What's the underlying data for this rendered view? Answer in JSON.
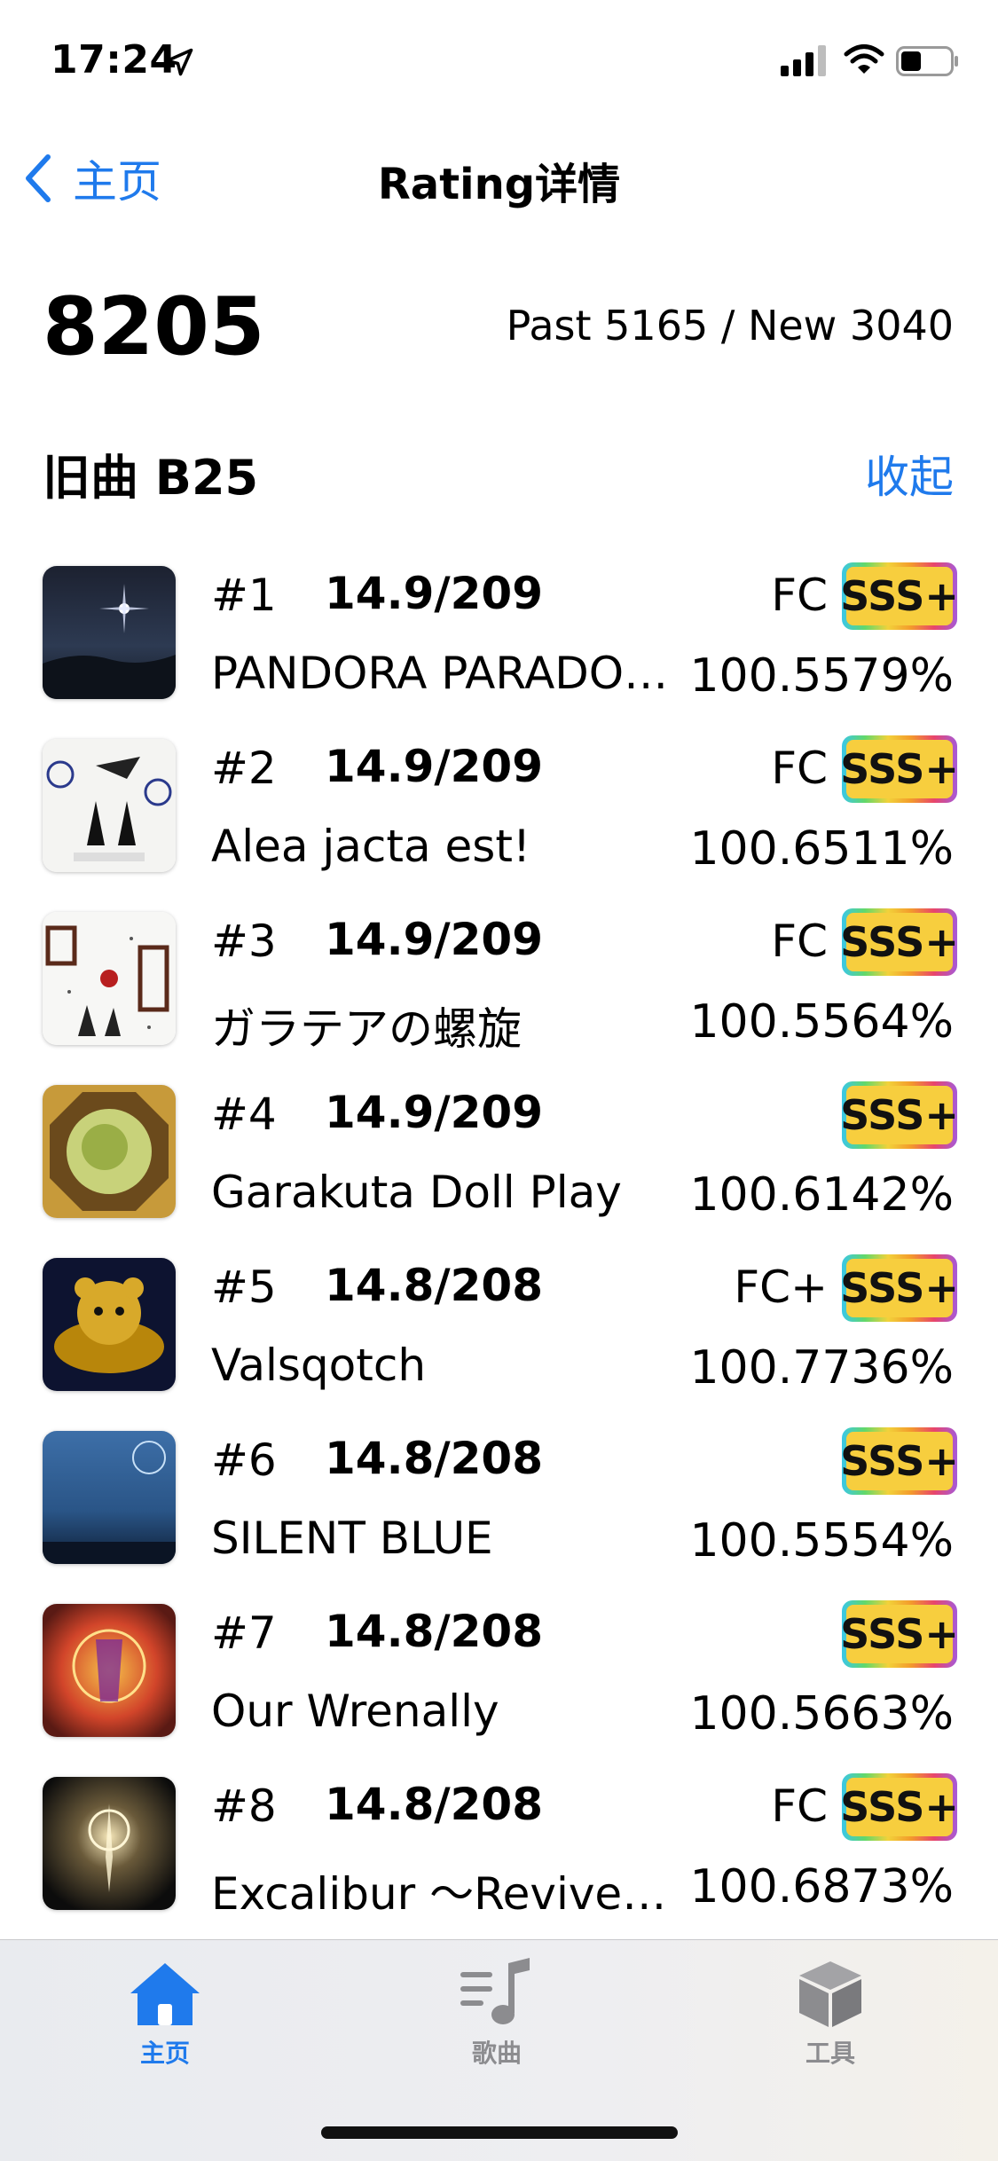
{
  "status_bar": {
    "time": "17:24"
  },
  "nav": {
    "back_label": "主页",
    "title": "Rating详情"
  },
  "summary": {
    "total": "8205",
    "breakdown": "Past 5165 / New 3040"
  },
  "section": {
    "title": "旧曲 B25",
    "toggle": "收起"
  },
  "songs": [
    {
      "rank": "#1",
      "level": "14.9/209",
      "title": "PANDORA PARADO…",
      "combo": "FC",
      "grade": "SSS+",
      "accuracy": "100.5579%"
    },
    {
      "rank": "#2",
      "level": "14.9/209",
      "title": "Alea jacta est!",
      "combo": "FC",
      "grade": "SSS+",
      "accuracy": "100.6511%"
    },
    {
      "rank": "#3",
      "level": "14.9/209",
      "title": "ガラテアの螺旋",
      "combo": "FC",
      "grade": "SSS+",
      "accuracy": "100.5564%"
    },
    {
      "rank": "#4",
      "level": "14.9/209",
      "title": "Garakuta Doll Play",
      "combo": "",
      "grade": "SSS+",
      "accuracy": "100.6142%"
    },
    {
      "rank": "#5",
      "level": "14.8/208",
      "title": "Valsqotch",
      "combo": "FC+",
      "grade": "SSS+",
      "accuracy": "100.7736%"
    },
    {
      "rank": "#6",
      "level": "14.8/208",
      "title": "SILENT BLUE",
      "combo": "",
      "grade": "SSS+",
      "accuracy": "100.5554%"
    },
    {
      "rank": "#7",
      "level": "14.8/208",
      "title": "Our Wrenally",
      "combo": "",
      "grade": "SSS+",
      "accuracy": "100.5663%"
    },
    {
      "rank": "#8",
      "level": "14.8/208",
      "title": "Excalibur ～Revived…",
      "combo": "FC",
      "grade": "SSS+",
      "accuracy": "100.6873%"
    }
  ],
  "tab_bar": {
    "home_label": "主页",
    "songs_label": "歌曲",
    "tools_label": "工具",
    "active_color": "#1f7aec",
    "inactive_color": "#8c8c8f"
  }
}
